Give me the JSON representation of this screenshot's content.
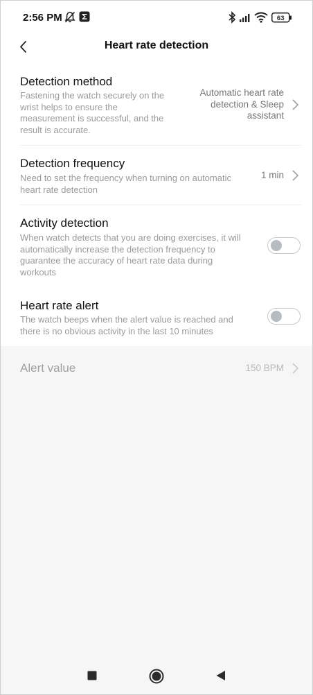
{
  "status_bar": {
    "time": "2:56 PM",
    "icons": [
      "alarm-off-icon",
      "app-notification-icon",
      "bluetooth-icon",
      "signal-icon",
      "wifi-icon",
      "battery-icon"
    ],
    "battery": "63"
  },
  "header": {
    "title": "Heart rate detection",
    "back_icon": "chevron-left-icon"
  },
  "settings": {
    "detection_method": {
      "title": "Detection method",
      "description": "Fastening the watch securely on the wrist helps to ensure the measurement is successful, and the result is accurate.",
      "value_line1": "Automatic heart rate",
      "value_line2": "detection & Sleep",
      "value_line3": "assistant"
    },
    "detection_frequency": {
      "title": "Detection frequency",
      "description": "Need to set the frequency when turning on automatic heart rate detection",
      "value": "1 min"
    },
    "activity_detection": {
      "title": "Activity detection",
      "description": "When watch detects that you are doing exercises, it will automatically increase the detection frequency to guarantee the accuracy of heart rate data during workouts",
      "enabled": false
    },
    "heart_rate_alert": {
      "title": "Heart rate alert",
      "description": "The watch beeps when the alert value is reached and there is no obvious activity in the last 10 minutes",
      "enabled": false
    },
    "alert_value": {
      "title": "Alert value",
      "value": "150 BPM"
    }
  },
  "nav_bar": {
    "icons": [
      "square-icon",
      "circle-icon",
      "triangle-back-icon"
    ]
  },
  "colors": {
    "background": "#f6f6f6",
    "card": "#ffffff",
    "secondary_text": "#9a9a9a",
    "toggle_knob": "#b7bcc2"
  }
}
